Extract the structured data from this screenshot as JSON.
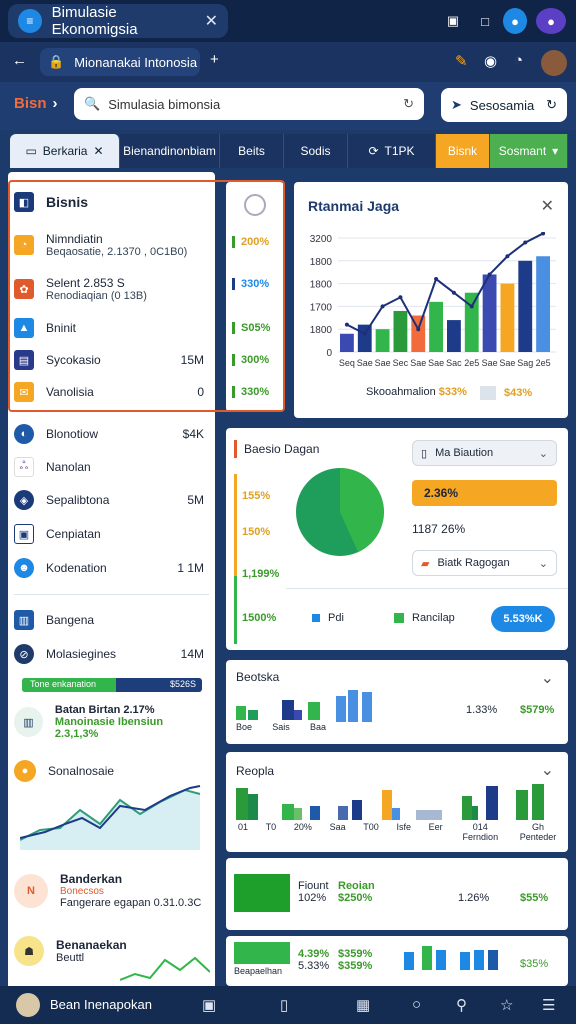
{
  "window": {
    "tab_title": "Bimulasie Ekonomigsia",
    "tab_close": "✕"
  },
  "address": {
    "url_text": "Mionanakai Intonosia"
  },
  "toolbar": {
    "crumb": "Bisn",
    "search_placeholder": "Simulasia bimonsia",
    "session_label": "Sesosamia"
  },
  "navtabs": [
    "Berkaria",
    "Bienandinonbiam",
    "Beits",
    "Sodis",
    "T1PK",
    "Bisnk",
    "Sosmant"
  ],
  "sidebar": {
    "top_items": [
      {
        "label": "Bisnis",
        "value": ""
      },
      {
        "label": "Nimndiatin",
        "sub": "Beqaosatie, 2.1370 , 0C1B0)",
        "value": ""
      },
      {
        "label": "Selent 2.853 S",
        "sub": "Renodiaqian (0 13B)",
        "value": ""
      },
      {
        "label": "Bninit",
        "value": ""
      },
      {
        "label": "Sycokasio",
        "value": "15M"
      },
      {
        "label": "Vanolisia",
        "value": "0"
      }
    ],
    "mid_items": [
      {
        "label": "Blonotiow",
        "value": "$4K"
      },
      {
        "label": "Nanolan",
        "value": ""
      },
      {
        "label": "Sepalibtona",
        "value": "5M"
      },
      {
        "label": "Cenpiatan",
        "value": ""
      },
      {
        "label": "Kodenation",
        "value": "1 1M"
      },
      {
        "label": "Bangena",
        "value": ""
      },
      {
        "label": "Molasiegines",
        "value": "14M"
      }
    ],
    "progress": {
      "left": "Tone enkanation",
      "right": "$526S",
      "value": 0.52
    },
    "card1": {
      "title": "Batan Birtan 2.17%",
      "sub": "Manoinasie Ibensiun 2.3,1,3%"
    },
    "card2": {
      "title": "Sonalnosaie"
    },
    "card3": {
      "title": "Banderkan",
      "sub1": "Bonecsos",
      "sub2": "Fangerare egapan 0.31.0.3C"
    },
    "card4": {
      "title": "Benanaekan",
      "sub": "Beuttl"
    }
  },
  "pctcol": [
    "200%",
    "330%",
    "S05%",
    "300%",
    "330%"
  ],
  "chart1": {
    "title": "Rtanmai Jaga",
    "legend1": "Skooahmalion",
    "legend1_val": "$33%",
    "legend2_val": "$43%"
  },
  "pie": {
    "title": "Baesio Dagan",
    "ylabels": [
      "155%",
      "150%",
      "1,199%",
      "1500%"
    ],
    "dd1": "Ma Biaution",
    "orange_val": "2.36%",
    "pct": "1187 26%",
    "dd2": "Biatk Ragogan",
    "legend1": "Pdi",
    "legend2": "Rancilap",
    "button": "5.53%K"
  },
  "row1": {
    "title": "Beotska",
    "v1": "1.33%",
    "v2": "$579%",
    "labels": [
      "Boe",
      "Sais",
      "Baa"
    ]
  },
  "row2": {
    "title": "Reopla",
    "labels": [
      "01",
      "T0",
      "20%",
      "Saa",
      "T00",
      "Isfe",
      "Eer",
      "014 Ferndion",
      "Gh Penteder"
    ]
  },
  "row3": {
    "l1": "Fiount",
    "l2": "102%",
    "g1": "Reoian",
    "g2": "$250%",
    "v1": "1.26%",
    "v2": "$55%"
  },
  "row4": {
    "l1": "4.39%",
    "l2": "5.33%",
    "g1": "$359%",
    "g2": "$359%",
    "v": "$35%",
    "foot": "Beapaelhan"
  },
  "bottom": {
    "label": "Bean Inenapokan"
  },
  "colors": {
    "accent": "#1e88e5",
    "green": "#32b54a",
    "orange": "#f5a623",
    "navy": "#1a3360"
  },
  "chart_data": {
    "type": "bar",
    "categories": [
      "Seq",
      "Sae",
      "Sae",
      "Sec",
      "Sae",
      "Sae",
      "Sac",
      "2e5",
      "Sae",
      "Sae",
      "Sag",
      "2e5"
    ],
    "values": [
      80,
      120,
      100,
      180,
      160,
      220,
      140,
      260,
      340,
      300,
      400,
      420
    ],
    "ylabels": [
      "3200",
      "1800",
      "1800",
      "1700",
      "1800",
      "0"
    ],
    "series": [
      {
        "name": "Skooahmalion",
        "values": [
          120,
          80,
          200,
          240,
          100,
          320,
          260,
          200,
          340,
          420,
          480,
          520
        ]
      }
    ]
  }
}
